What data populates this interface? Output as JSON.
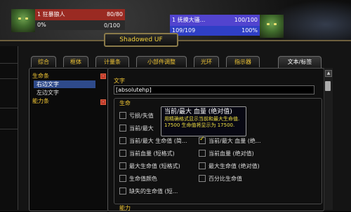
{
  "player": {
    "name": "1 狂暴狼人",
    "hp_text": "80/80",
    "hp_fraction": 1.0,
    "power_left": "0%",
    "power_right": "0/100",
    "power_fraction": 0.0
  },
  "target": {
    "name": "1 抚摸大骚...",
    "hp_text": "100/100",
    "hp_fraction": 1.0,
    "power_left": "109/109",
    "power_right": "100%",
    "power_fraction": 1.0
  },
  "window": {
    "title": "Shadowed UF"
  },
  "tabs": [
    "综合",
    "框体",
    "计量条",
    "小部件调整",
    "光环",
    "指示器",
    "文本/标签"
  ],
  "tree": {
    "items": [
      {
        "label": "生命条",
        "level": 0
      },
      {
        "label": "右边文字",
        "level": 1,
        "selected": true
      },
      {
        "label": "左边文字",
        "level": 1
      },
      {
        "label": "能力条",
        "level": 0
      }
    ],
    "toggle_symbol": "-"
  },
  "content": {
    "text_label": "文字",
    "text_value": "[absolutehp]",
    "group_label": "生命",
    "options": [
      {
        "label": "亏损/失值",
        "checked": false
      },
      {
        "label": "当前/最大",
        "checked": false
      },
      {
        "label": "当前/最大 生命值 (简...",
        "checked": false
      },
      {
        "label": "当前/最大 血量 (绝...",
        "checked": true
      },
      {
        "label": "当前血量 (短格式)",
        "checked": false
      },
      {
        "label": "当前血量 (绝对值)",
        "checked": false
      },
      {
        "label": "最大生命值 (短格式)",
        "checked": false
      },
      {
        "label": "最大生命值 (绝对值)",
        "checked": false
      },
      {
        "label": "生命值颜色",
        "checked": false
      },
      {
        "label": "百分比生命值",
        "checked": false
      },
      {
        "label": "缺失的生命值 (短...",
        "checked": false
      }
    ],
    "bottom_label": "能力"
  },
  "tooltip": {
    "title": "当前/最大 血量 (绝对值)",
    "desc_line1": "用精确格式显示当前和最大生命值.",
    "desc_line2": "17500 生命值将显示为 17500."
  },
  "scroll": {
    "up_icon": "▲"
  },
  "colors": {
    "accent_gold": "#f0c533",
    "selection_blue": "#2e4a8a",
    "player_hp": "#9a2a22",
    "target_hp": "#5244cf"
  }
}
